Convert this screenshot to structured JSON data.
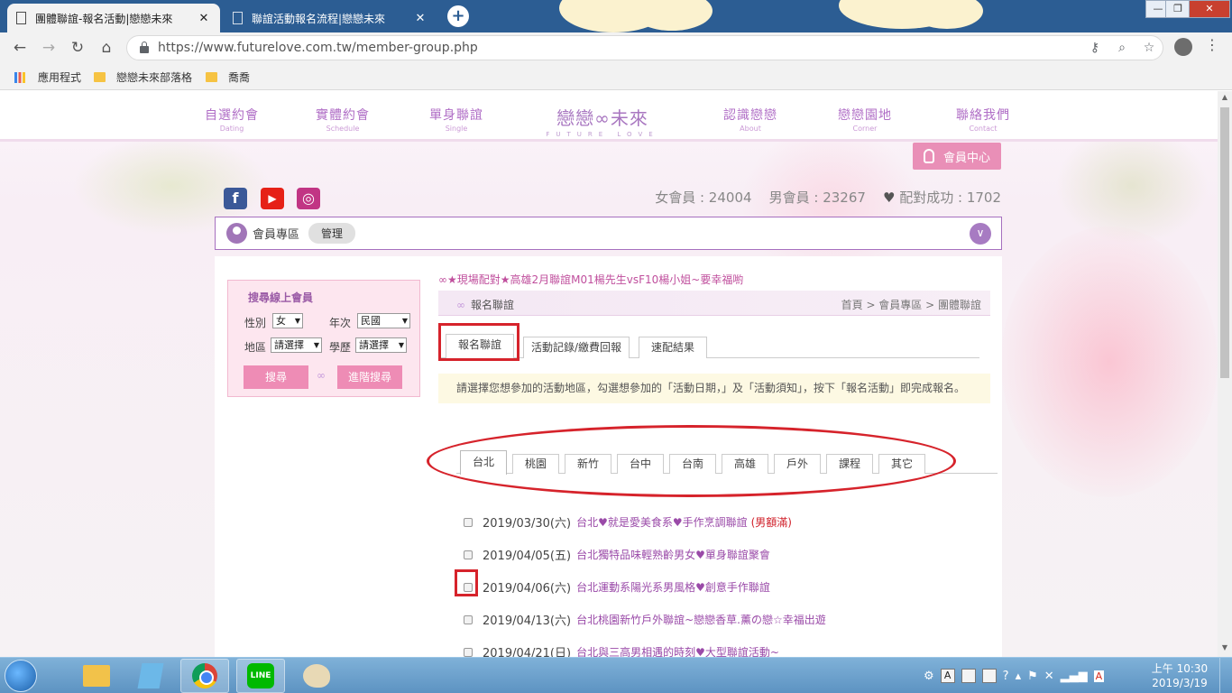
{
  "browser": {
    "tabs": [
      {
        "title": "團體聯誼-報名活動|戀戀未來",
        "active": true
      },
      {
        "title": "聯誼活動報名流程|戀戀未來",
        "active": false
      }
    ],
    "url": "https://www.futurelove.com.tw/member-group.php",
    "bookmarks": [
      {
        "label": "應用程式",
        "icon": "apps-grid-icon"
      },
      {
        "label": "戀戀未來部落格",
        "icon": "folder-icon"
      },
      {
        "label": "喬喬",
        "icon": "folder-icon"
      }
    ]
  },
  "site": {
    "nav_left": [
      {
        "zh": "自選約會",
        "en": "Dating"
      },
      {
        "zh": "實體約會",
        "en": "Schedule"
      },
      {
        "zh": "單身聯誼",
        "en": "Single"
      }
    ],
    "logo": {
      "main": "戀戀∞未來",
      "sub": "FUTURE LOVE"
    },
    "nav_right": [
      {
        "zh": "認識戀戀",
        "en": "About"
      },
      {
        "zh": "戀戀園地",
        "en": "Corner"
      },
      {
        "zh": "聯絡我們",
        "en": "Contact"
      }
    ],
    "member_center": "會員中心",
    "social": [
      {
        "icon": "facebook-icon",
        "glyph": "f",
        "color": "#3b5998"
      },
      {
        "icon": "youtube-icon",
        "glyph": "▶",
        "color": "#e62117"
      },
      {
        "icon": "instagram-icon",
        "glyph": "◎",
        "color": "#c13584"
      }
    ],
    "stats": {
      "female": "女會員 : 24004",
      "male": "男會員 : 23267",
      "matched": "配對成功 : 1702"
    },
    "member_bar": {
      "label": "會員專區",
      "manage": "管理",
      "expand": "∨"
    },
    "search": {
      "title": "搜尋線上會員",
      "gender_label": "性別",
      "gender_value": "女",
      "year_label": "年次",
      "year_value": "民國",
      "area_label": "地區",
      "area_value": "請選擇",
      "edu_label": "學歷",
      "edu_value": "請選擇",
      "search_btn": "搜尋",
      "advanced_btn": "進階搜尋"
    },
    "marquee": "∞★現場配對★高雄2月聯誼M01楊先生vsF10楊小姐~要幸福喲",
    "section": {
      "title": "報名聯誼",
      "breadcrumb": "首頁 > 會員專區 > 團體聯誼"
    },
    "subtabs": [
      "報名聯誼",
      "活動記錄/繳費回報",
      "速配結果"
    ],
    "notice": "請選擇您想參加的活動地區，勾選想參加的「活動日期，」及「活動須知」，按下「報名活動」即完成報名。",
    "regions": [
      "台北",
      "桃園",
      "新竹",
      "台中",
      "台南",
      "高雄",
      "戶外",
      "課程",
      "其它"
    ],
    "events": [
      {
        "date": "2019/03/30(六)",
        "title": "台北♥就是愛美食系♥手作烹調聯誼",
        "tag": "(男額滿)"
      },
      {
        "date": "2019/04/05(五)",
        "title": "台北獨特品味輕熟齡男女♥單身聯誼聚會",
        "tag": ""
      },
      {
        "date": "2019/04/06(六)",
        "title": "台北運動系陽光系男風格♥創意手作聯誼",
        "tag": ""
      },
      {
        "date": "2019/04/13(六)",
        "title": "台北桃園新竹戶外聯誼~戀戀香草.薰の戀☆幸福出遊",
        "tag": ""
      },
      {
        "date": "2019/04/21(日)",
        "title": "台北與三高男相遇的時刻♥大型聯誼活動~",
        "tag": ""
      }
    ]
  },
  "taskbar": {
    "apps": [
      "folder-app",
      "book-app",
      "chrome-app",
      "line-app",
      "paint-app"
    ],
    "line_label": "LINE",
    "tray": [
      "A",
      "?"
    ],
    "time": "上午 10:30",
    "date": "2019/3/19"
  }
}
